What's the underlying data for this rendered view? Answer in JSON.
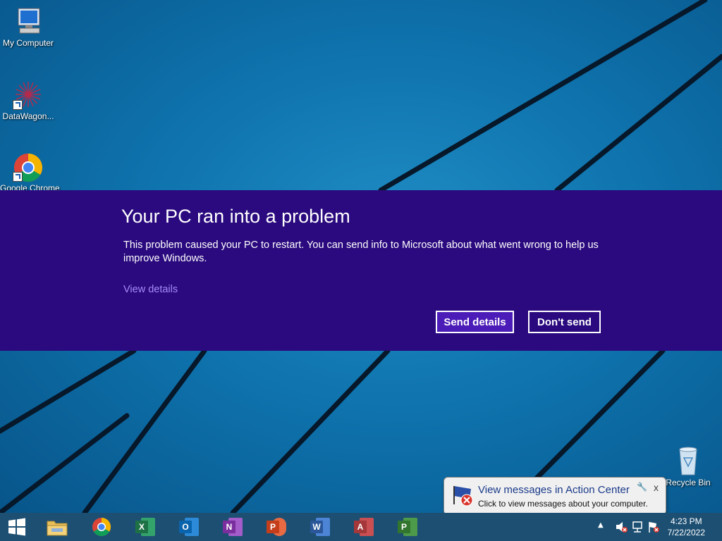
{
  "desktop": {
    "icons": [
      {
        "label": "My Computer"
      },
      {
        "label": "DataWagon..."
      },
      {
        "label": "Google Chrome"
      },
      {
        "label": "Recycle Bin"
      }
    ]
  },
  "error_dialog": {
    "title": "Your PC ran into a problem",
    "message": "This problem caused your PC to restart. You can send info to Microsoft about what went wrong to help us improve Windows.",
    "view_details": "View details",
    "send_label": "Send details",
    "dont_send_label": "Don't send"
  },
  "notification": {
    "title": "View messages in Action Center",
    "text": "Click to view messages about your computer.",
    "close": "x"
  },
  "taskbar": {
    "apps": [
      "start",
      "file-explorer",
      "chrome",
      "excel",
      "outlook",
      "onenote",
      "powerpoint",
      "word",
      "access",
      "project"
    ],
    "office_letters": {
      "excel": "X",
      "outlook": "O",
      "onenote": "N",
      "powerpoint": "P",
      "word": "W",
      "access": "A",
      "project": "P"
    },
    "colors": {
      "excel": "#1e7145",
      "outlook": "#0a64ad",
      "onenote": "#7b2f9e",
      "powerpoint": "#c43e1c",
      "word": "#2b579a",
      "access": "#a4373a",
      "project": "#31752f"
    },
    "clock_time": "4:23 PM",
    "clock_date": "7/22/2022"
  }
}
